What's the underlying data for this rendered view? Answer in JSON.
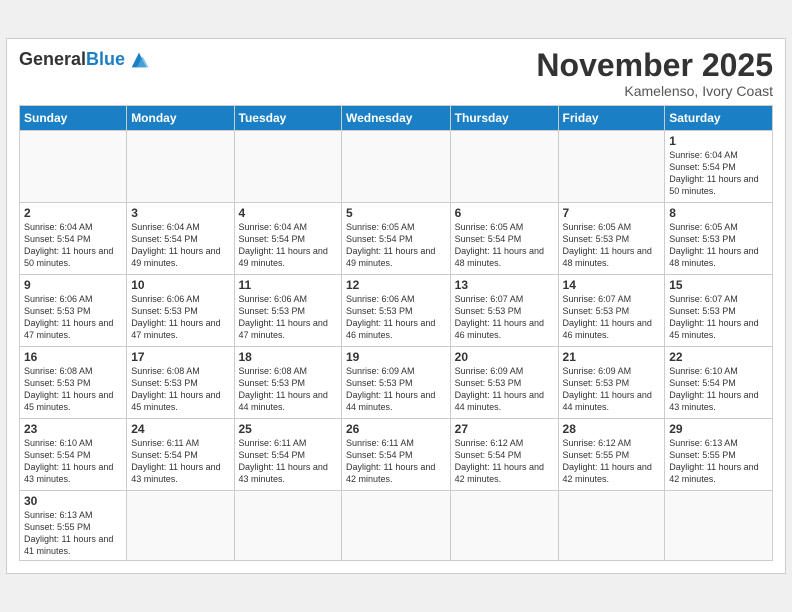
{
  "header": {
    "logo_general": "General",
    "logo_blue": "Blue",
    "month": "November 2025",
    "location": "Kamelenso, Ivory Coast"
  },
  "weekdays": [
    "Sunday",
    "Monday",
    "Tuesday",
    "Wednesday",
    "Thursday",
    "Friday",
    "Saturday"
  ],
  "days": {
    "d1": {
      "num": "1",
      "sunrise": "6:04 AM",
      "sunset": "5:54 PM",
      "daylight": "11 hours and 50 minutes."
    },
    "d2": {
      "num": "2",
      "sunrise": "6:04 AM",
      "sunset": "5:54 PM",
      "daylight": "11 hours and 50 minutes."
    },
    "d3": {
      "num": "3",
      "sunrise": "6:04 AM",
      "sunset": "5:54 PM",
      "daylight": "11 hours and 49 minutes."
    },
    "d4": {
      "num": "4",
      "sunrise": "6:04 AM",
      "sunset": "5:54 PM",
      "daylight": "11 hours and 49 minutes."
    },
    "d5": {
      "num": "5",
      "sunrise": "6:05 AM",
      "sunset": "5:54 PM",
      "daylight": "11 hours and 49 minutes."
    },
    "d6": {
      "num": "6",
      "sunrise": "6:05 AM",
      "sunset": "5:54 PM",
      "daylight": "11 hours and 48 minutes."
    },
    "d7": {
      "num": "7",
      "sunrise": "6:05 AM",
      "sunset": "5:53 PM",
      "daylight": "11 hours and 48 minutes."
    },
    "d8": {
      "num": "8",
      "sunrise": "6:05 AM",
      "sunset": "5:53 PM",
      "daylight": "11 hours and 48 minutes."
    },
    "d9": {
      "num": "9",
      "sunrise": "6:06 AM",
      "sunset": "5:53 PM",
      "daylight": "11 hours and 47 minutes."
    },
    "d10": {
      "num": "10",
      "sunrise": "6:06 AM",
      "sunset": "5:53 PM",
      "daylight": "11 hours and 47 minutes."
    },
    "d11": {
      "num": "11",
      "sunrise": "6:06 AM",
      "sunset": "5:53 PM",
      "daylight": "11 hours and 47 minutes."
    },
    "d12": {
      "num": "12",
      "sunrise": "6:06 AM",
      "sunset": "5:53 PM",
      "daylight": "11 hours and 46 minutes."
    },
    "d13": {
      "num": "13",
      "sunrise": "6:07 AM",
      "sunset": "5:53 PM",
      "daylight": "11 hours and 46 minutes."
    },
    "d14": {
      "num": "14",
      "sunrise": "6:07 AM",
      "sunset": "5:53 PM",
      "daylight": "11 hours and 46 minutes."
    },
    "d15": {
      "num": "15",
      "sunrise": "6:07 AM",
      "sunset": "5:53 PM",
      "daylight": "11 hours and 45 minutes."
    },
    "d16": {
      "num": "16",
      "sunrise": "6:08 AM",
      "sunset": "5:53 PM",
      "daylight": "11 hours and 45 minutes."
    },
    "d17": {
      "num": "17",
      "sunrise": "6:08 AM",
      "sunset": "5:53 PM",
      "daylight": "11 hours and 45 minutes."
    },
    "d18": {
      "num": "18",
      "sunrise": "6:08 AM",
      "sunset": "5:53 PM",
      "daylight": "11 hours and 44 minutes."
    },
    "d19": {
      "num": "19",
      "sunrise": "6:09 AM",
      "sunset": "5:53 PM",
      "daylight": "11 hours and 44 minutes."
    },
    "d20": {
      "num": "20",
      "sunrise": "6:09 AM",
      "sunset": "5:53 PM",
      "daylight": "11 hours and 44 minutes."
    },
    "d21": {
      "num": "21",
      "sunrise": "6:09 AM",
      "sunset": "5:53 PM",
      "daylight": "11 hours and 44 minutes."
    },
    "d22": {
      "num": "22",
      "sunrise": "6:10 AM",
      "sunset": "5:54 PM",
      "daylight": "11 hours and 43 minutes."
    },
    "d23": {
      "num": "23",
      "sunrise": "6:10 AM",
      "sunset": "5:54 PM",
      "daylight": "11 hours and 43 minutes."
    },
    "d24": {
      "num": "24",
      "sunrise": "6:11 AM",
      "sunset": "5:54 PM",
      "daylight": "11 hours and 43 minutes."
    },
    "d25": {
      "num": "25",
      "sunrise": "6:11 AM",
      "sunset": "5:54 PM",
      "daylight": "11 hours and 43 minutes."
    },
    "d26": {
      "num": "26",
      "sunrise": "6:11 AM",
      "sunset": "5:54 PM",
      "daylight": "11 hours and 42 minutes."
    },
    "d27": {
      "num": "27",
      "sunrise": "6:12 AM",
      "sunset": "5:54 PM",
      "daylight": "11 hours and 42 minutes."
    },
    "d28": {
      "num": "28",
      "sunrise": "6:12 AM",
      "sunset": "5:55 PM",
      "daylight": "11 hours and 42 minutes."
    },
    "d29": {
      "num": "29",
      "sunrise": "6:13 AM",
      "sunset": "5:55 PM",
      "daylight": "11 hours and 42 minutes."
    },
    "d30": {
      "num": "30",
      "sunrise": "6:13 AM",
      "sunset": "5:55 PM",
      "daylight": "11 hours and 41 minutes."
    }
  },
  "labels": {
    "sunrise": "Sunrise:",
    "sunset": "Sunset:",
    "daylight": "Daylight:"
  }
}
